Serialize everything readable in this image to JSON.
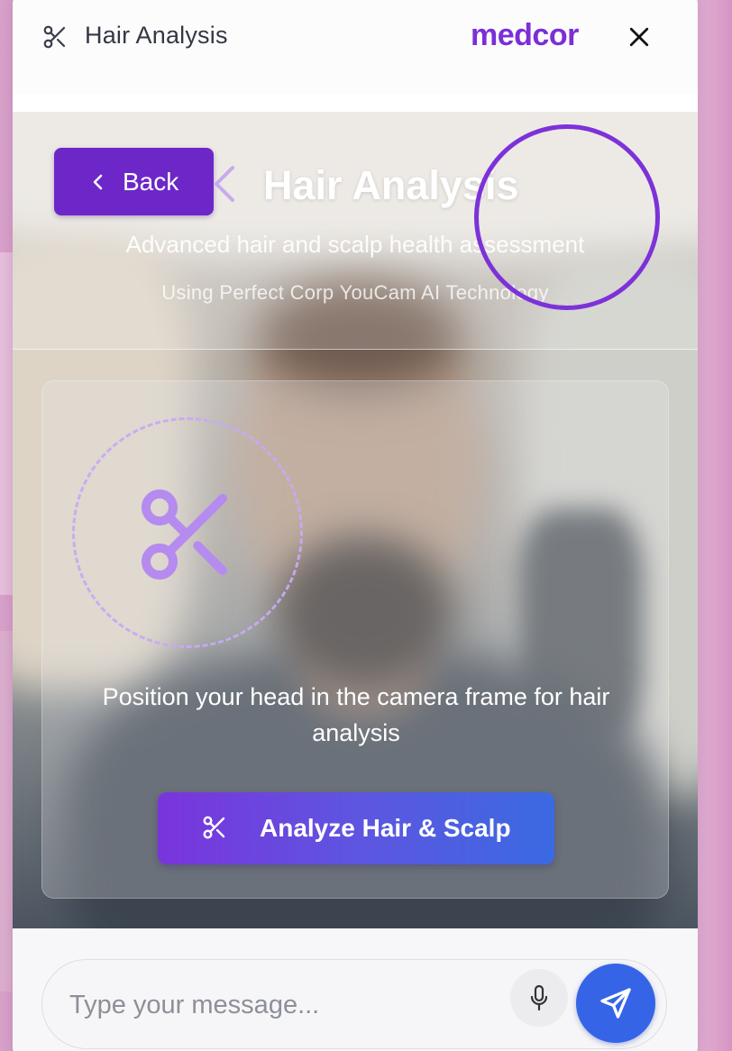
{
  "header": {
    "title": "Hair Analysis",
    "brand": "medcor",
    "icon": "scissors-icon",
    "close_icon": "close-icon"
  },
  "hero": {
    "back_label": "Back",
    "title": "Hair Analysis",
    "subtitle": "Advanced hair and scalp health assessment",
    "tech_line": "Using Perfect Corp YouCam AI Technology"
  },
  "card": {
    "instruction": "Position your head in the camera frame for hair analysis",
    "analyze_label": "Analyze Hair & Scalp",
    "icon": "scissors-icon"
  },
  "composer": {
    "placeholder": "Type your message...",
    "mic_icon": "microphone-icon",
    "send_icon": "send-icon"
  },
  "colors": {
    "brand": "#7b2fd6",
    "back_button": "#6d27c9",
    "send_button": "#3565e6",
    "analyze_gradient_start": "#7a34dc",
    "analyze_gradient_end": "#3a6ae2",
    "focus_ring": "#7d32d8"
  }
}
